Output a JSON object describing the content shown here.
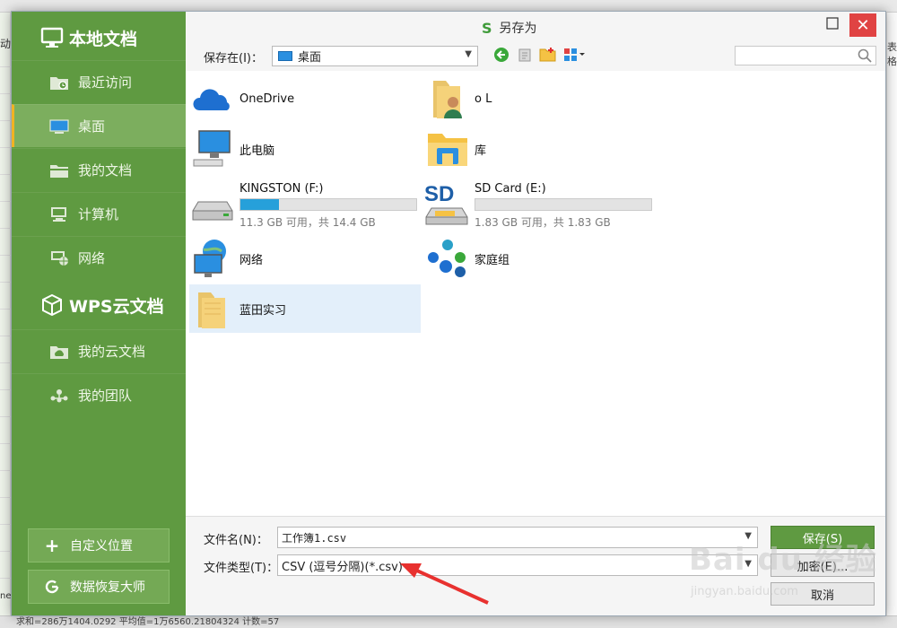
{
  "background_app": {
    "left_fragments": [
      "动",
      "nee"
    ],
    "right_fragment": "表格"
  },
  "dialog": {
    "title": "另存为",
    "title_logo": "S",
    "close_glyph": "✕"
  },
  "sidebar": {
    "local_header": "本地文档",
    "cloud_header": "WPS云文档",
    "local_items": [
      {
        "label": "最近访问",
        "icon": "recent-folder-icon"
      },
      {
        "label": "桌面",
        "icon": "desktop-icon",
        "active": true
      },
      {
        "label": "我的文档",
        "icon": "documents-folder-icon"
      },
      {
        "label": "计算机",
        "icon": "computer-icon"
      },
      {
        "label": "网络",
        "icon": "network-icon"
      }
    ],
    "cloud_items": [
      {
        "label": "我的云文档",
        "icon": "cloud-folder-icon"
      },
      {
        "label": "我的团队",
        "icon": "team-icon"
      }
    ],
    "buttons": [
      {
        "label": "自定义位置",
        "icon": "plus-icon"
      },
      {
        "label": "数据恢复大师",
        "icon": "recovery-icon"
      }
    ]
  },
  "toolbar": {
    "save_in_label": "保存在(I)：",
    "save_in_value": "桌面",
    "search_placeholder": ""
  },
  "files": [
    {
      "name": "OneDrive",
      "icon": "onedrive-icon"
    },
    {
      "name": "o L",
      "icon": "user-folder-icon"
    },
    {
      "name": "此电脑",
      "icon": "this-pc-icon"
    },
    {
      "name": "库",
      "icon": "library-icon"
    },
    {
      "name": "KINGSTON (F:)",
      "icon": "usb-drive-icon",
      "usage": 0.22,
      "space": "11.3 GB 可用，共 14.4 GB"
    },
    {
      "name": "SD Card (E:)",
      "icon": "sd-card-icon",
      "usage": 0.0,
      "space": "1.83 GB 可用，共 1.83 GB"
    },
    {
      "name": "网络",
      "icon": "network-globe-icon"
    },
    {
      "name": "家庭组",
      "icon": "homegroup-icon"
    },
    {
      "name": "蓝田实习",
      "icon": "folder-icon",
      "selected": true
    }
  ],
  "bottom": {
    "filename_label": "文件名(N)：",
    "filename_value": "工作簿1.csv",
    "filetype_label": "文件类型(T)：",
    "filetype_value": "CSV (逗号分隔)(*.csv)",
    "save_button": "保存(S)",
    "encrypt_button": "加密(E)...",
    "cancel_button": "取消"
  },
  "watermark": {
    "brand": "Bai du 经验",
    "url": "jingyan.baidu.com"
  },
  "status_bar": {
    "text": "求和=286万1404.0292  平均值=1万6560.21804324 计数=57"
  },
  "colors": {
    "sidebar_green": "#5f9a41",
    "sidebar_active": "#7cae5e",
    "active_marker": "#f0b323",
    "close_red": "#e04343",
    "drive_fill": "#26a0da",
    "arrow_red": "#e8312f"
  }
}
